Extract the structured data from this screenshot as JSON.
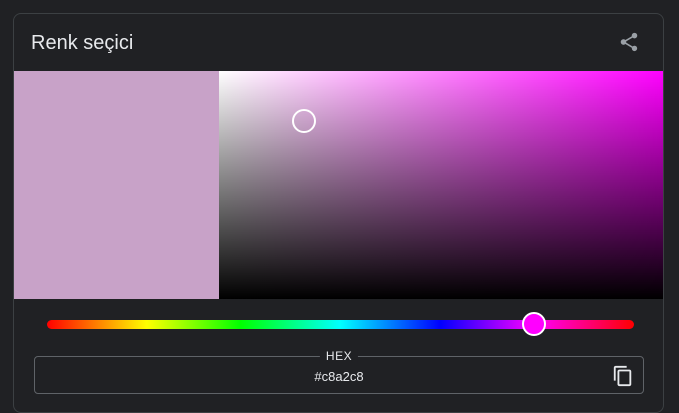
{
  "widget": {
    "title": "Renk seçici"
  },
  "picker": {
    "selected_color": "#c8a2c8",
    "hue_color": "#ff00ff",
    "saturation_fraction": 0.19,
    "value_fraction": 0.78,
    "hue_fraction": 0.83
  },
  "hex_field": {
    "label": "HEX",
    "value": "#c8a2c8"
  },
  "icons": {
    "share": "share-icon",
    "copy": "copy-icon"
  },
  "colors": {
    "background": "#202124",
    "border": "#3c4043",
    "text": "#e8eaed",
    "icon": "#9aa0a6"
  }
}
